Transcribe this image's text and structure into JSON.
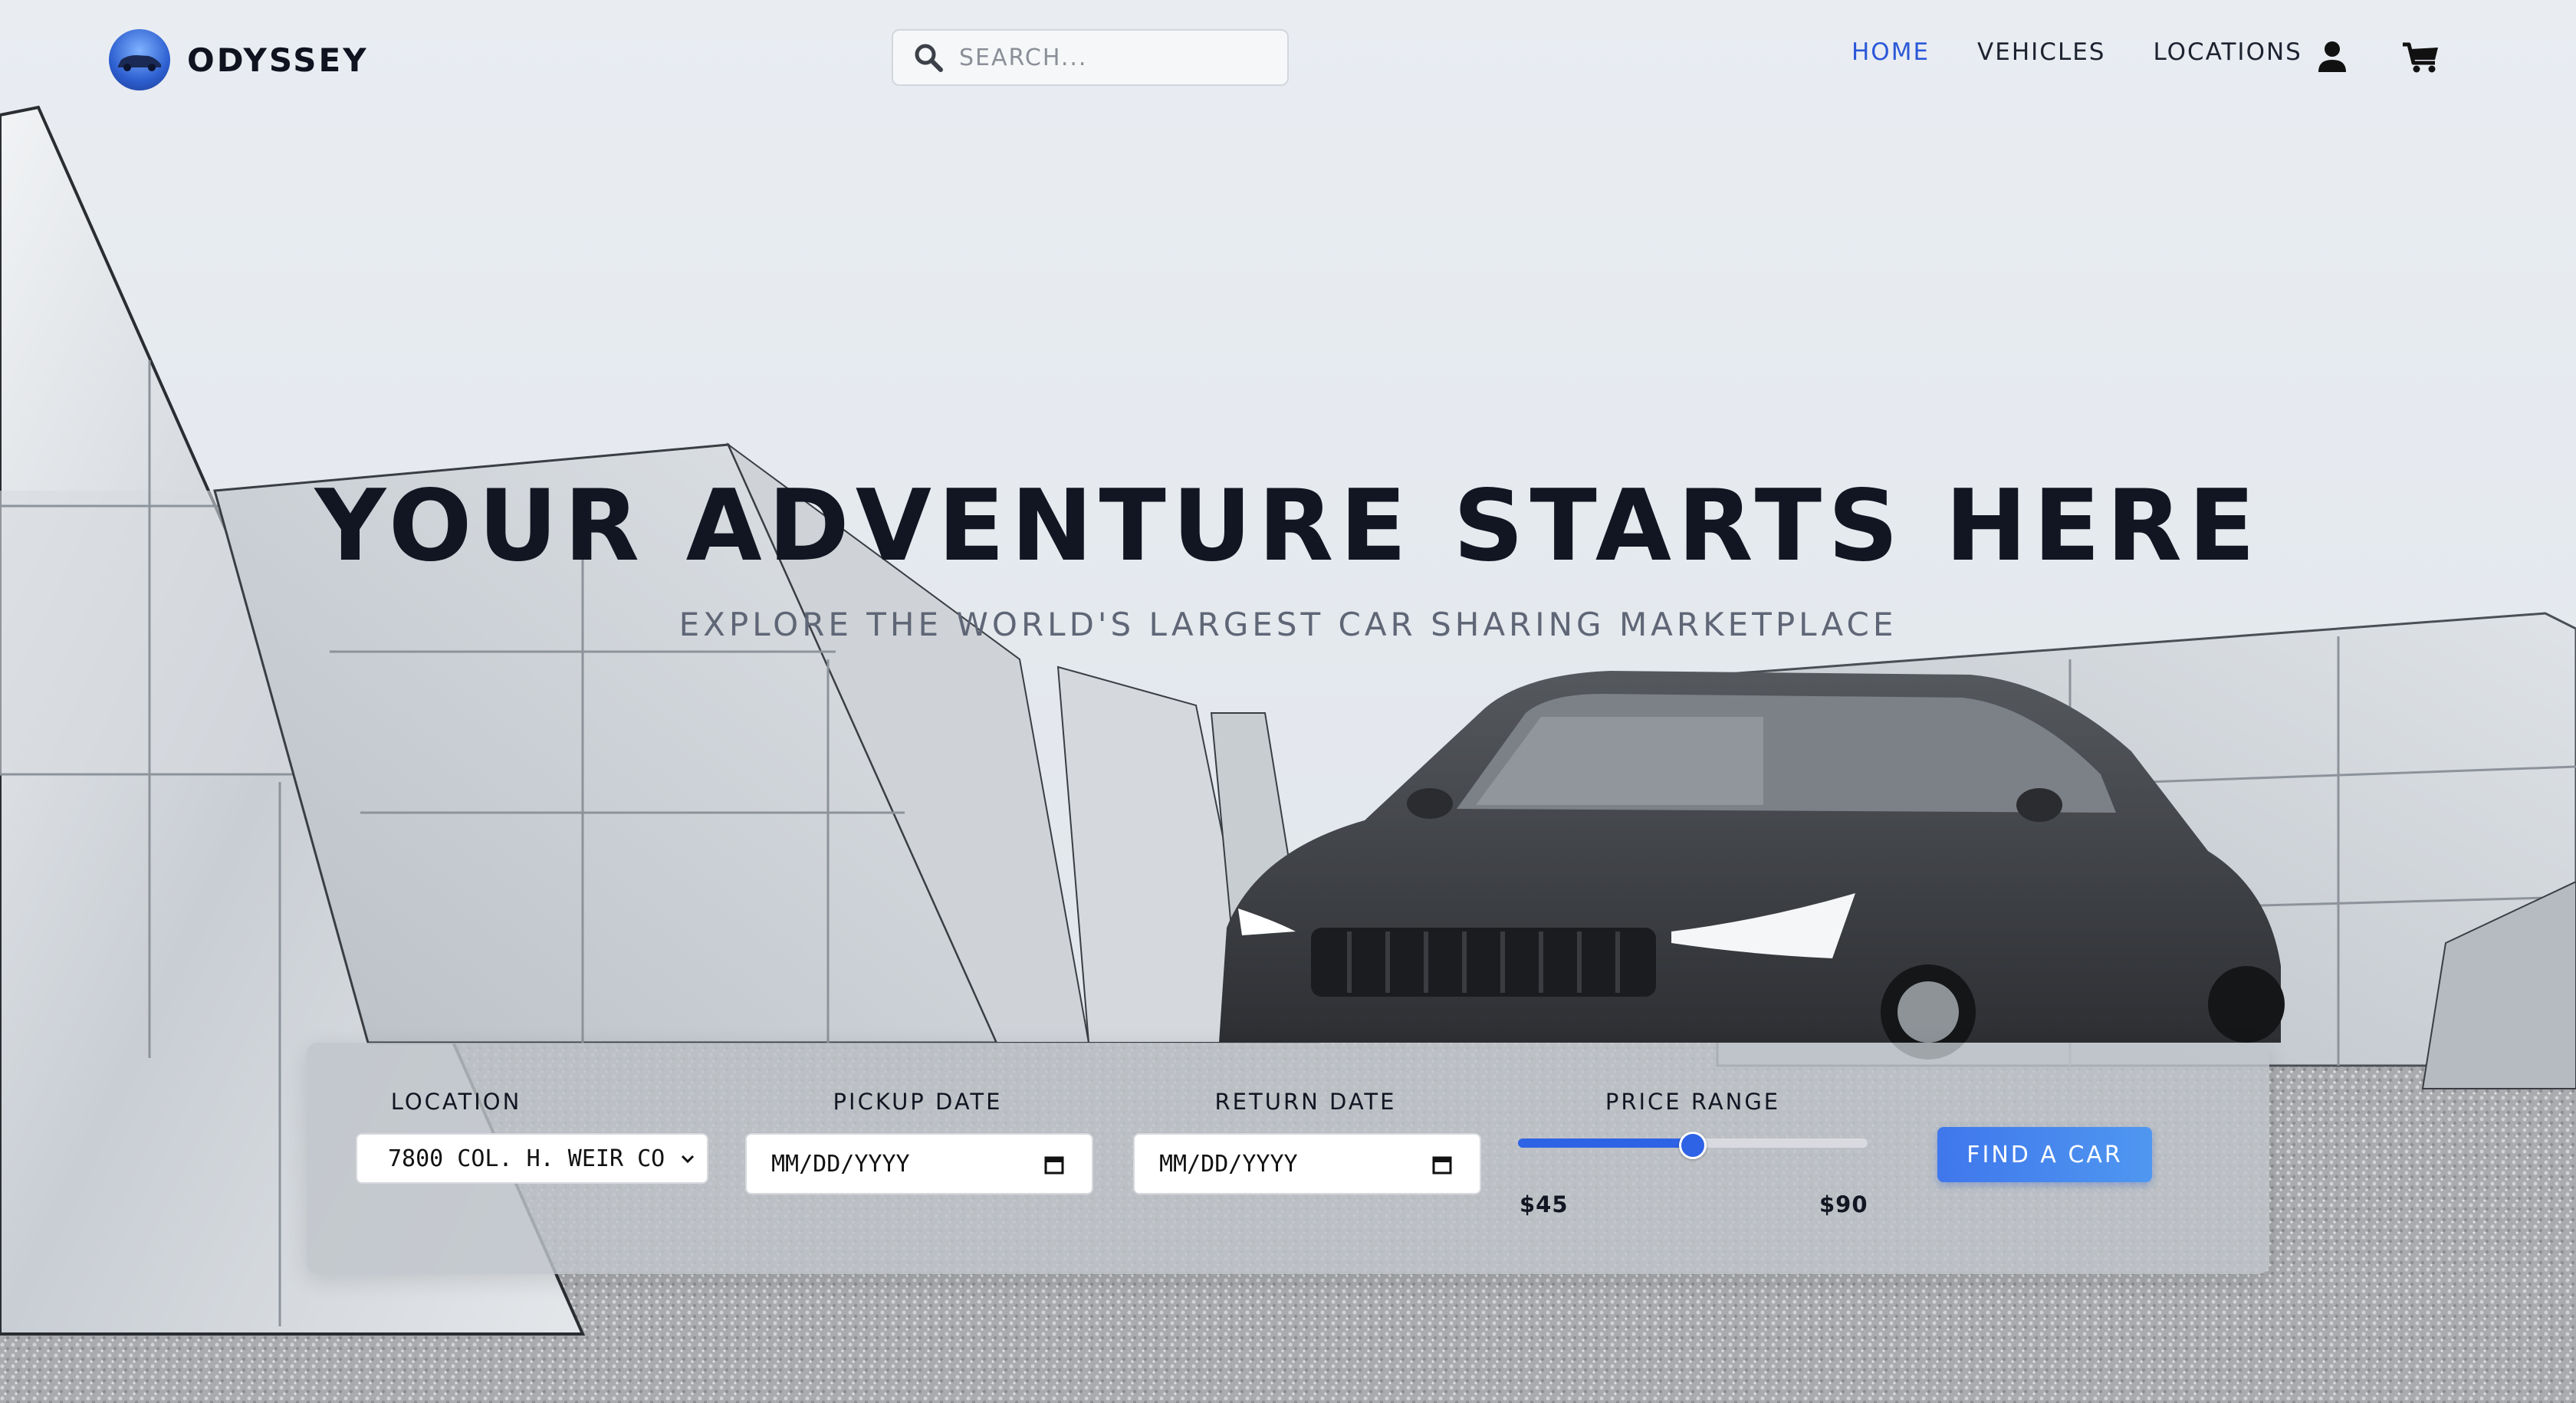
{
  "brand": {
    "name": "ODYSSEY",
    "logo_icon": "car-logo-icon"
  },
  "search": {
    "placeholder": "SEARCH...",
    "icon": "search-icon"
  },
  "nav": {
    "items": [
      {
        "label": "HOME",
        "active": true
      },
      {
        "label": "VEHICLES",
        "active": false
      },
      {
        "label": "LOCATIONS",
        "active": false
      }
    ],
    "icons": [
      "user-icon",
      "cart-icon"
    ]
  },
  "hero": {
    "title": "YOUR ADVENTURE STARTS HERE",
    "subtitle": "EXPLORE THE WORLD'S LARGEST CAR SHARING MARKETPLACE"
  },
  "booking": {
    "location": {
      "label": "LOCATION",
      "value": "7800 COL. H. WEIR CO"
    },
    "pickup": {
      "label": "PICKUP DATE",
      "value": "MM/DD/YYYY"
    },
    "return": {
      "label": "RETURN DATE",
      "value": "MM/DD/YYYY"
    },
    "price": {
      "label": "PRICE RANGE",
      "min": "$45",
      "max": "$90",
      "level": 0.5
    },
    "submit_label": "FIND A CAR"
  },
  "colors": {
    "accent": "#2b58d8",
    "button": "#4585ee",
    "text_dark": "#121622"
  }
}
